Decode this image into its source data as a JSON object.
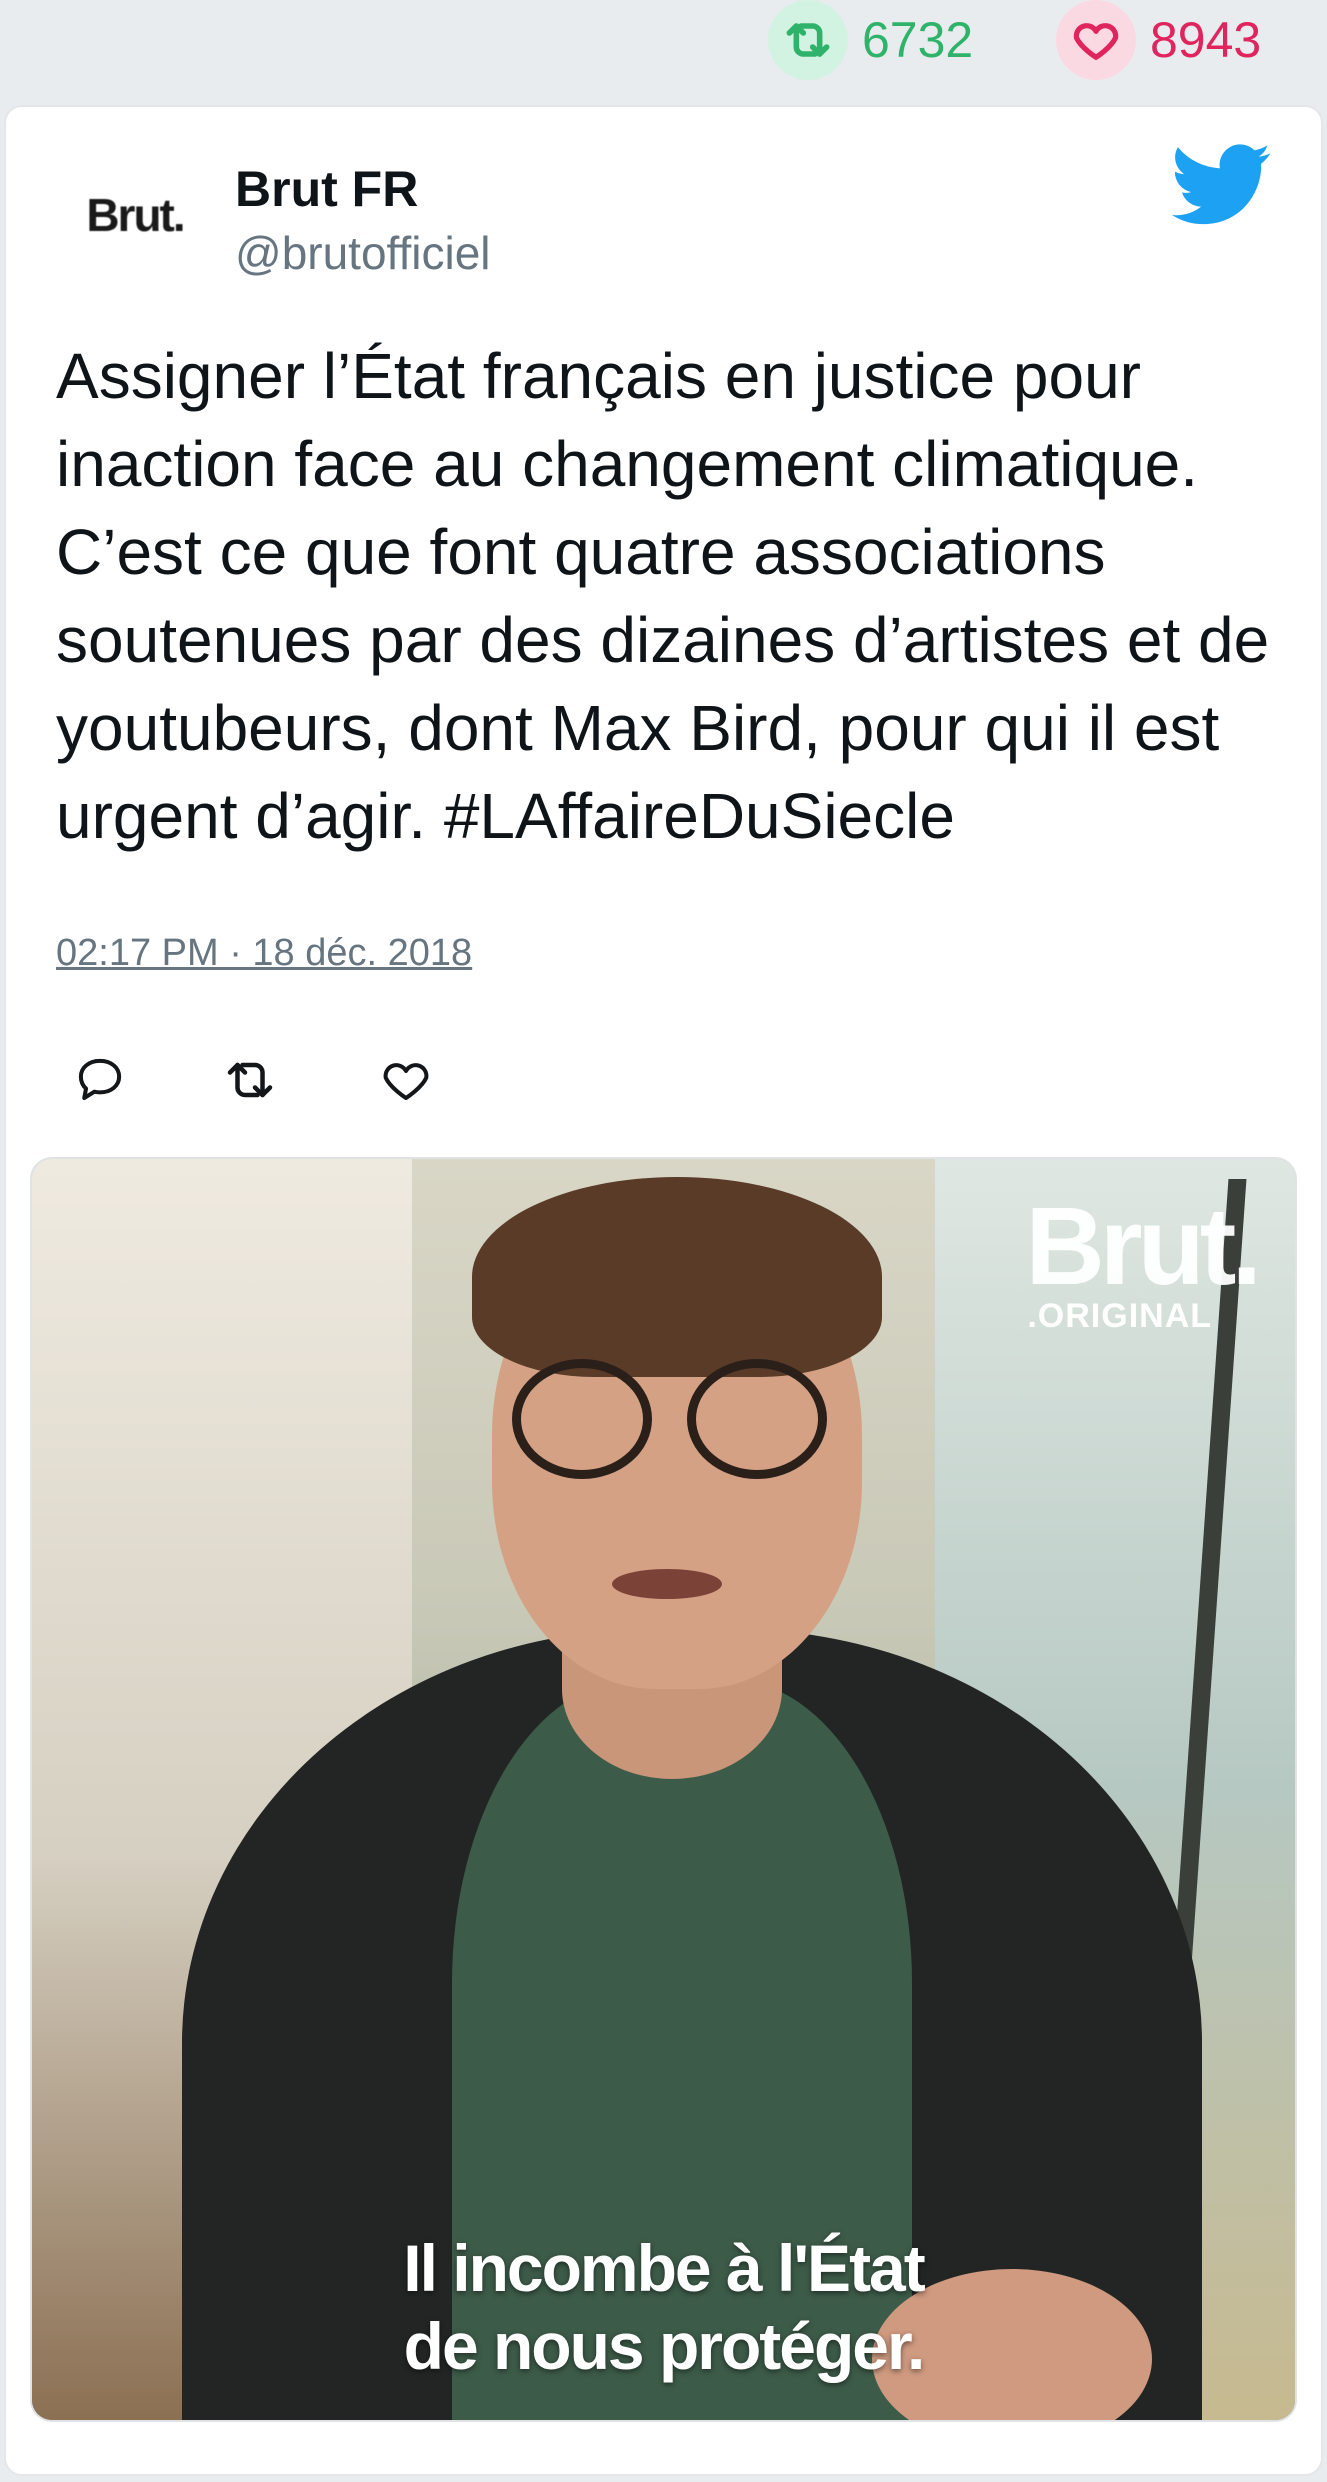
{
  "stats": {
    "retweets": "6732",
    "likes": "8943"
  },
  "author": {
    "avatar_text": "Brut.",
    "name": "Brut FR",
    "handle": "@brutofficiel"
  },
  "tweet": {
    "text": "Assigner l’État français en justice pour inaction face au changement climatique. C’est ce que font quatre associations soutenues par des dizaines d’artistes et de youtubeurs, dont Max Bird, pour qui il est urgent d’agir. #LAffaireDuSiecle",
    "timestamp": "02:17 PM · 18 déc. 2018"
  },
  "media": {
    "logo_main": "Brut.",
    "logo_sub": ".ORIGINAL",
    "caption_line1": "Il incombe à l'État",
    "caption_line2": "de nous protéger."
  },
  "icons": {
    "retweet": "retweet-icon",
    "like": "heart-icon",
    "reply": "reply-icon",
    "brand": "twitter-bird-icon"
  },
  "colors": {
    "retweet": "#2fb36b",
    "like": "#e0245e",
    "twitter_blue": "#1da1f2",
    "muted": "#66757f"
  }
}
